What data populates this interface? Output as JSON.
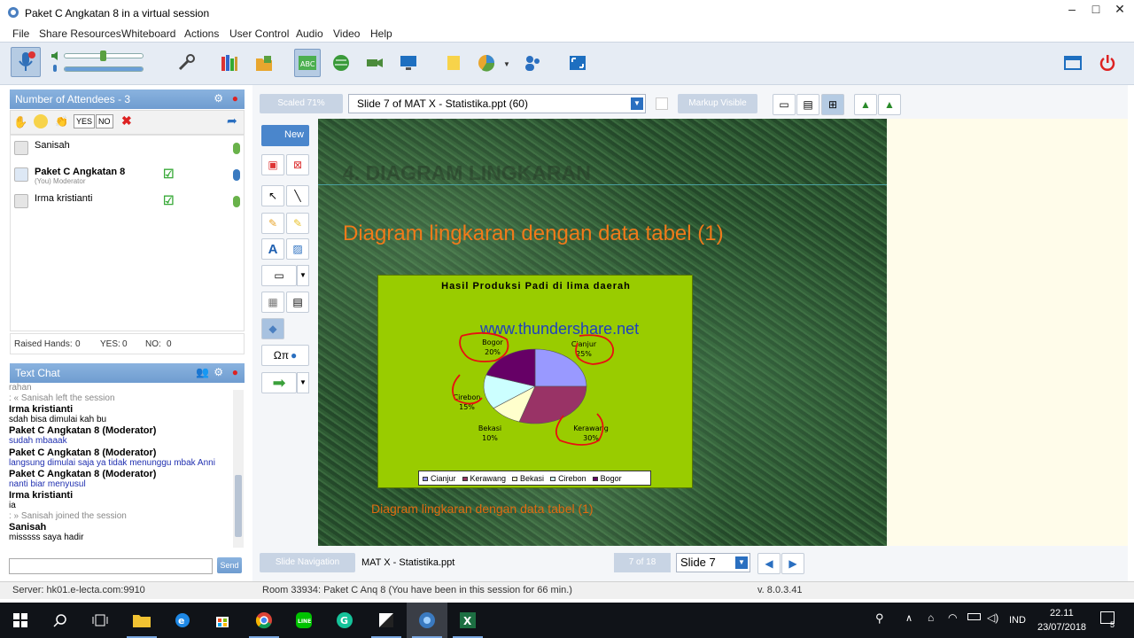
{
  "window": {
    "title": "Paket C Angkatan 8 in a virtual session",
    "min": "–",
    "max": "□",
    "close": "✕"
  },
  "menu": [
    "File",
    "Share Resources",
    "Whiteboard",
    "Actions",
    "User Control",
    "Audio",
    "Video",
    "Help"
  ],
  "attendees": {
    "header": "Number of Attendees - 3",
    "list": [
      {
        "name": "Sanisah",
        "sub": ""
      },
      {
        "name": "Paket C Angkatan 8",
        "sub": "(You) Moderator"
      },
      {
        "name": "Irma kristianti",
        "sub": ""
      }
    ],
    "stats": {
      "raised": "Raised Hands:",
      "raised_v": "0",
      "yes": "YES:",
      "yes_v": "0",
      "no": "NO:",
      "no_v": "0"
    },
    "btn_yes": "YES",
    "btn_no": "NO"
  },
  "chat": {
    "header": "Text Chat",
    "lines": [
      {
        "t": "rahan",
        "c": "g"
      },
      {
        "t": ": « Sanisah left the session",
        "c": "g"
      },
      {
        "t": "Irma kristianti",
        "c": "b"
      },
      {
        "t": "sdah bisa dimulai kah bu",
        "c": ""
      },
      {
        "t": "Paket C Angkatan 8 (Moderator)",
        "c": "b"
      },
      {
        "t": "sudah mbaaak",
        "c": "bl"
      },
      {
        "t": "Paket C Angkatan 8 (Moderator)",
        "c": "b"
      },
      {
        "t": "langsung dimulai saja ya tidak menunggu mbak Anni",
        "c": "bl"
      },
      {
        "t": "Paket C Angkatan 8 (Moderator)",
        "c": "b"
      },
      {
        "t": "nanti biar menyusul",
        "c": "bl"
      },
      {
        "t": "Irma kristianti",
        "c": "b"
      },
      {
        "t": "ia",
        "c": ""
      },
      {
        "t": ": » Sanisah joined the session",
        "c": "g"
      },
      {
        "t": "Sanisah",
        "c": "b"
      },
      {
        "t": "misssss saya hadir",
        "c": ""
      }
    ],
    "input_value": "",
    "send": "Send"
  },
  "topbar": {
    "scaled": "Scaled 71%",
    "slide_select": "Slide 7 of MAT X - Statistika.ppt (60)",
    "markup": "Markup Visible"
  },
  "tools": {
    "new": "New",
    "symbols": "Ωπ"
  },
  "slide": {
    "heading": "4. DIAGRAM LINGKARAN",
    "subtitle": "Diagram lingkaran dengan data tabel (1)",
    "caption": "Diagram lingkaran dengan data tabel (1)",
    "watermark": "www.thundershare.net"
  },
  "chart_data": {
    "type": "pie",
    "title": "Hasil Produksi Padi di lima daerah",
    "categories": [
      "Cianjur",
      "Kerawang",
      "Bekasi",
      "Cirebon",
      "Bogor"
    ],
    "values": [
      25,
      30,
      10,
      15,
      20
    ],
    "labels": [
      "25%",
      "30%",
      "10%",
      "15%",
      "20%"
    ],
    "colors": [
      "#9999ff",
      "#993366",
      "#ffffcc",
      "#ccffff",
      "#660066"
    ],
    "legend": "bottom"
  },
  "bottombar": {
    "nav": "Slide Navigation",
    "file": "MAT X - Statistika.ppt",
    "count": "7 of 18",
    "slide": "Slide 7"
  },
  "status": {
    "server": "Server: hk01.e-lecta.com:9910",
    "room": "Room 33934: Paket C Anq 8 (You have been in this session for 66 min.)",
    "version": "v. 8.0.3.41"
  },
  "taskbar": {
    "lang": "IND",
    "time": "22.11",
    "date": "23/07/2018",
    "notif": "5"
  }
}
